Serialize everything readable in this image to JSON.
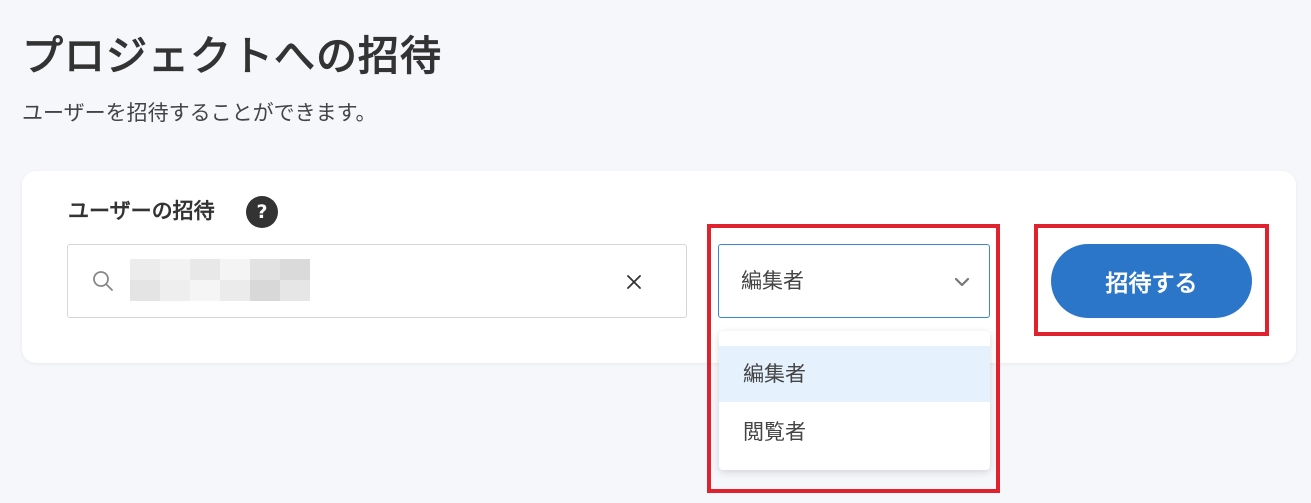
{
  "page": {
    "title": "プロジェクトへの招待",
    "subtitle": "ユーザーを招待することができます。"
  },
  "invite_card": {
    "label": "ユーザーの招待",
    "help_glyph": "?",
    "search_icon": "search-icon",
    "clear_icon": "close-icon",
    "role_select": {
      "value": "編集者",
      "options": [
        "編集者",
        "閲覧者"
      ],
      "selected_index": 0,
      "icon": "chevron-down-icon"
    },
    "submit_label": "招待する"
  },
  "colors": {
    "background": "#f6f7fb",
    "primary": "#2b76c9",
    "highlight": "#e0212e",
    "selected_option": "#e5f1fc",
    "select_border": "#3d86cf"
  }
}
